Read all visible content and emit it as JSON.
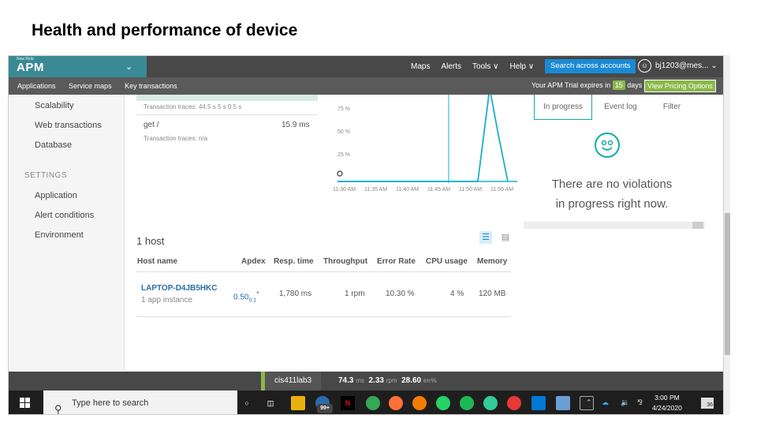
{
  "slide": {
    "title": "Health and performance of device"
  },
  "topbar": {
    "brand_small": "New Relic",
    "brand": "APM",
    "nav": [
      "Maps",
      "Alerts",
      "Tools ∨",
      "Help ∨"
    ],
    "search_button": "Search across accounts",
    "user": "bj1203@mes..."
  },
  "subbar": {
    "items": [
      "Applications",
      "Service maps",
      "Key transactions"
    ],
    "trial_prefix": "Your APM Trial expires in",
    "trial_days": "15",
    "trial_suffix": "days",
    "pricing": "View Pricing Options"
  },
  "sidebar": {
    "items_top": [
      "Scalability",
      "Web transactions",
      "Database"
    ],
    "settings_heading": "SETTINGS",
    "items_settings": [
      "Application",
      "Alert conditions",
      "Environment"
    ]
  },
  "transactions": {
    "row1_traces": "Transaction traces:  44.5 s   5 s   0.5 s",
    "row2_name": "get /",
    "row2_time": "15.9 ms",
    "row2_traces": "Transaction traces:  n/a"
  },
  "chart_data": {
    "type": "line",
    "x": [
      "11:30 AM",
      "11:35 AM",
      "11:40 AM",
      "11:45 AM",
      "11:50 AM",
      "11:55 AM"
    ],
    "y_ticks": [
      "75 %",
      "50 %",
      "25 %"
    ],
    "series": [
      {
        "values": [
          0,
          0,
          0,
          0,
          0,
          100,
          50,
          0
        ]
      }
    ],
    "color": "#1ab0c8"
  },
  "violations": {
    "tabs": [
      "In progress",
      "Event log",
      "Filter"
    ],
    "message_line1": "There are no violations",
    "message_line2": "in progress right now."
  },
  "hosts": {
    "title": "1 host",
    "columns": [
      "Host name",
      "Apdex",
      "Resp. time",
      "Throughput",
      "Error Rate",
      "CPU usage",
      "Memory"
    ],
    "rows": [
      {
        "name": "LAPTOP-D4JB5HKC",
        "instances": "1 app instance",
        "apdex": "0.50",
        "apdex_sub": "0.1",
        "apdex_mark": "*",
        "resp": "1,780 ms",
        "throughput": "1 rpm",
        "error": "10.30 %",
        "cpu": "4 %",
        "memory": "120 MB"
      }
    ]
  },
  "statusbar": {
    "app": "cis411lab3",
    "resp": "74.3",
    "resp_unit": "ms",
    "rpm": "2.33",
    "rpm_unit": "rpm",
    "err": "28.60",
    "err_unit": "err%"
  },
  "taskbar": {
    "search_placeholder": "Type here to search",
    "time": "3:00 PM",
    "date": "4/24/2020",
    "badge_99": "99+",
    "notif_count": "36"
  }
}
